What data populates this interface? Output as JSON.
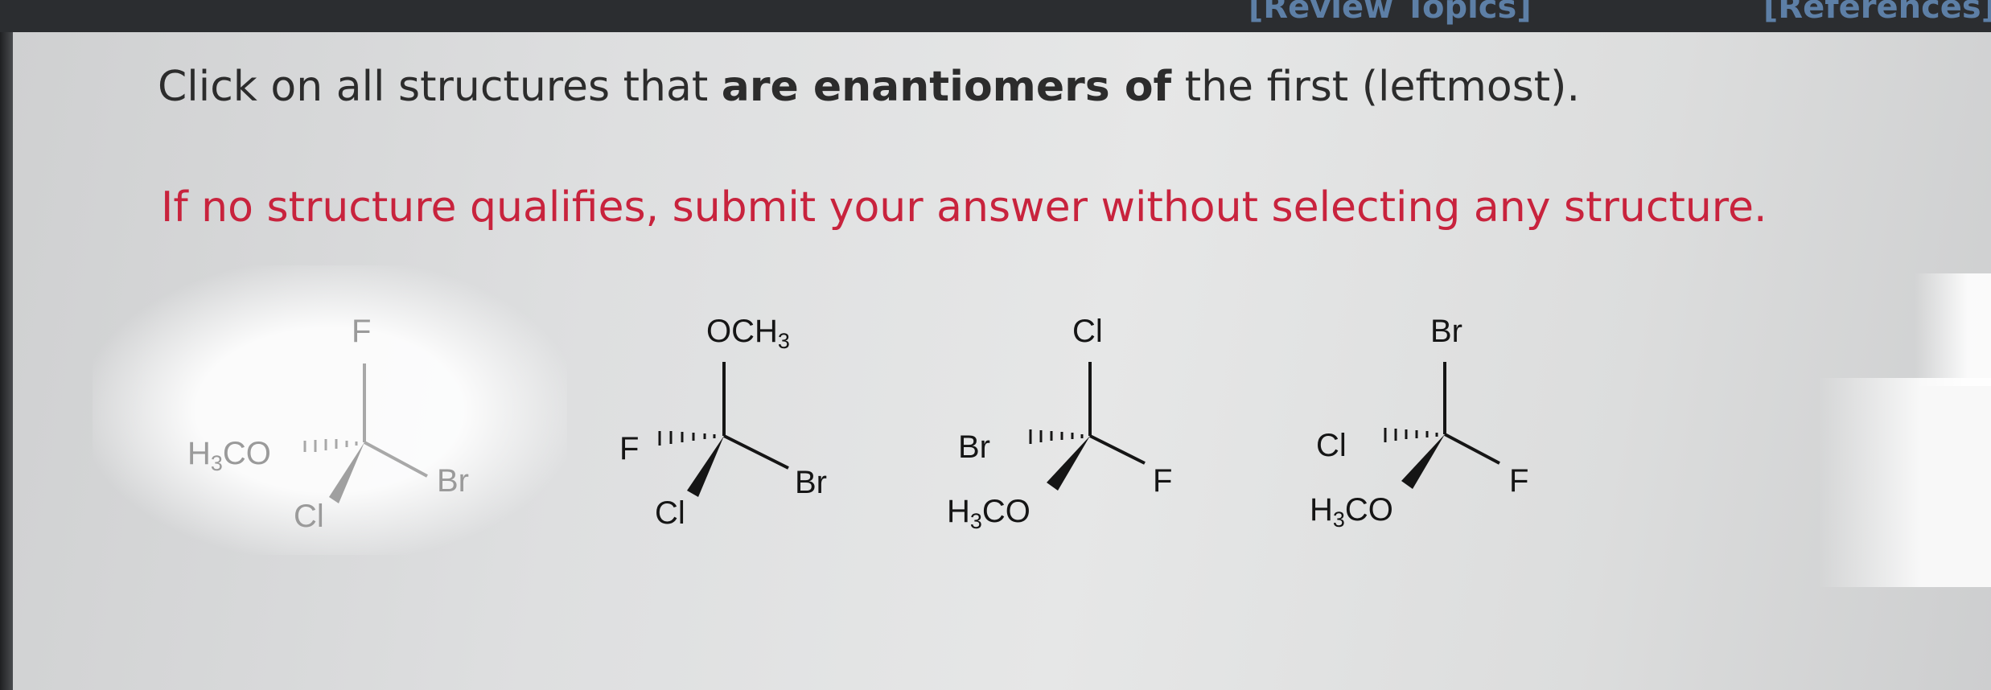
{
  "header": {
    "review_topics": "[Review Topics]",
    "references": "[References]"
  },
  "question": {
    "prefix": "Click on all structures that ",
    "bold": "are enantiomers of",
    "suffix": " the first (leftmost).",
    "note": "If no structure qualifies, submit your answer without selecting any structure."
  },
  "structures": [
    {
      "top": "F",
      "left": "H3CO",
      "wedge": "Cl",
      "right": "Br"
    },
    {
      "top": "OCH3",
      "left": "F",
      "wedge": "Cl",
      "right": "Br"
    },
    {
      "top": "Cl",
      "left": "Br",
      "wedge": "H3CO",
      "right": "F"
    },
    {
      "top": "Br",
      "left": "Cl",
      "wedge": "H3CO",
      "right": "F"
    }
  ],
  "colors": {
    "note_red": "#c8233d",
    "link_blue": "#5d7fa6"
  }
}
